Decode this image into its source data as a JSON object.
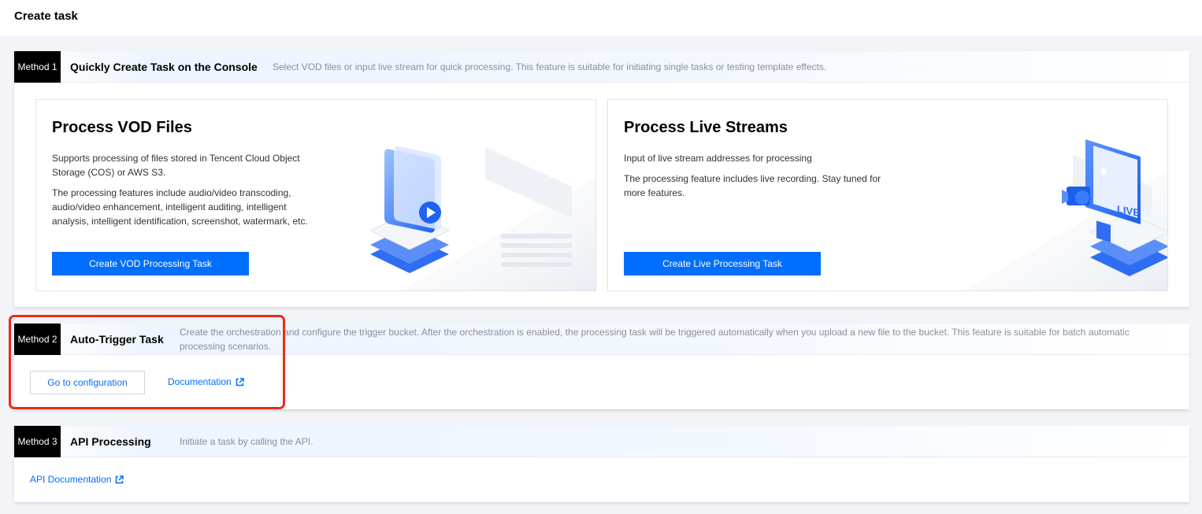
{
  "page": {
    "title": "Create task"
  },
  "method1": {
    "badge": "Method 1",
    "title": "Quickly Create Task on the Console",
    "description": "Select VOD files or input live stream for quick processing. This feature is suitable for initiating single tasks or testing template effects.",
    "vod": {
      "title": "Process VOD Files",
      "paragraph1": "Supports processing of files stored in Tencent Cloud Object Storage (COS) or AWS S3.",
      "paragraph2": "The processing features include audio/video transcoding, audio/video enhancement, intelligent auditing, intelligent analysis, intelligent identification, screenshot, watermark, etc.",
      "button_label": "Create VOD Processing Task"
    },
    "live": {
      "title": "Process Live Streams",
      "paragraph1": "Input of live stream addresses for processing",
      "paragraph2": "The processing feature includes live recording. Stay tuned for more features.",
      "button_label": "Create Live Processing Task",
      "illustration_text": "LIVE"
    }
  },
  "method2": {
    "badge": "Method 2",
    "title": "Auto-Trigger Task",
    "description": "Create the orchestration and configure the trigger bucket. After the orchestration is enabled, the processing task will be triggered automatically when you upload a new file to the bucket. This feature is suitable for batch automatic processing scenarios.",
    "config_button_label": "Go to configuration",
    "doc_link_label": "Documentation"
  },
  "method3": {
    "badge": "Method 3",
    "title": "API Processing",
    "description": "Initiate a task by calling the API.",
    "api_doc_link_label": "API Documentation"
  },
  "colors": {
    "primary": "#006eff",
    "badge_bg": "#000000",
    "highlight": "#ee2a1b",
    "page_bg": "#f2f4f8"
  },
  "icons": {
    "external_link": "external-link-icon",
    "vod_illustration": "folder-play-illustration",
    "live_illustration": "live-stream-illustration"
  }
}
